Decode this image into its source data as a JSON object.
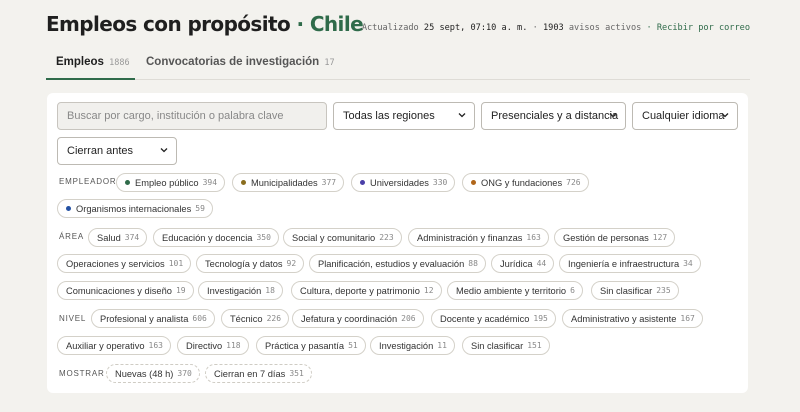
{
  "header": {
    "title": "Empleos con propósito",
    "separator": "·",
    "country": "Chile",
    "updated_prefix": "Actualizado",
    "updated_date": "25 sept, 07:10 a. m.",
    "dot": "·",
    "active_count": "1903",
    "active_suffix": "avisos activos",
    "email_link": "Recibir por correo",
    "accent_color": "#2f6b4a"
  },
  "tabs": [
    {
      "label": "Empleos",
      "count": "1886",
      "active": true
    },
    {
      "label": "Convocatorias de investigación",
      "count": "17",
      "active": false
    }
  ],
  "filters": {
    "search_placeholder": "Buscar por cargo, institución o palabra clave",
    "region": "Todas las regiones",
    "modality": "Presenciales y a distancia",
    "language": "Cualquier idioma",
    "sort": "Cierran antes"
  },
  "employer": {
    "label": "EMPLEADOR",
    "chips": [
      {
        "label": "Empleo público",
        "count": "394",
        "color": "#2f6b4a"
      },
      {
        "label": "Municipalidades",
        "count": "377",
        "color": "#8a6d1f"
      },
      {
        "label": "Universidades",
        "count": "330",
        "color": "#4a3fa8"
      },
      {
        "label": "ONG y fundaciones",
        "count": "726",
        "color": "#b0661a"
      },
      {
        "label": "Organismos internacionales",
        "count": "59",
        "color": "#2451a3"
      }
    ]
  },
  "area": {
    "label": "ÁREA",
    "chips": [
      {
        "label": "Salud",
        "count": "374"
      },
      {
        "label": "Educación y docencia",
        "count": "350"
      },
      {
        "label": "Social y comunitario",
        "count": "223"
      },
      {
        "label": "Administración y finanzas",
        "count": "163"
      },
      {
        "label": "Gestión de personas",
        "count": "127"
      },
      {
        "label": "Operaciones y servicios",
        "count": "101"
      },
      {
        "label": "Tecnología y datos",
        "count": "92"
      },
      {
        "label": "Planificación, estudios y evaluación",
        "count": "88"
      },
      {
        "label": "Jurídica",
        "count": "44"
      },
      {
        "label": "Ingeniería e infraestructura",
        "count": "34"
      },
      {
        "label": "Comunicaciones y diseño",
        "count": "19"
      },
      {
        "label": "Investigación",
        "count": "18"
      },
      {
        "label": "Cultura, deporte y patrimonio",
        "count": "12"
      },
      {
        "label": "Medio ambiente y territorio",
        "count": "6"
      },
      {
        "label": "Sin clasificar",
        "count": "235"
      }
    ]
  },
  "level": {
    "label": "NIVEL",
    "chips": [
      {
        "label": "Profesional y analista",
        "count": "606"
      },
      {
        "label": "Técnico",
        "count": "226"
      },
      {
        "label": "Jefatura y coordinación",
        "count": "206"
      },
      {
        "label": "Docente y académico",
        "count": "195"
      },
      {
        "label": "Administrativo y asistente",
        "count": "167"
      },
      {
        "label": "Auxiliar y operativo",
        "count": "163"
      },
      {
        "label": "Directivo",
        "count": "118"
      },
      {
        "label": "Práctica y pasantía",
        "count": "51"
      },
      {
        "label": "Investigación",
        "count": "11"
      },
      {
        "label": "Sin clasificar",
        "count": "151"
      }
    ]
  },
  "show": {
    "label": "MOSTRAR",
    "chips": [
      {
        "label": "Nuevas (48 h)",
        "count": "370"
      },
      {
        "label": "Cierran en 7 días",
        "count": "351"
      }
    ]
  }
}
